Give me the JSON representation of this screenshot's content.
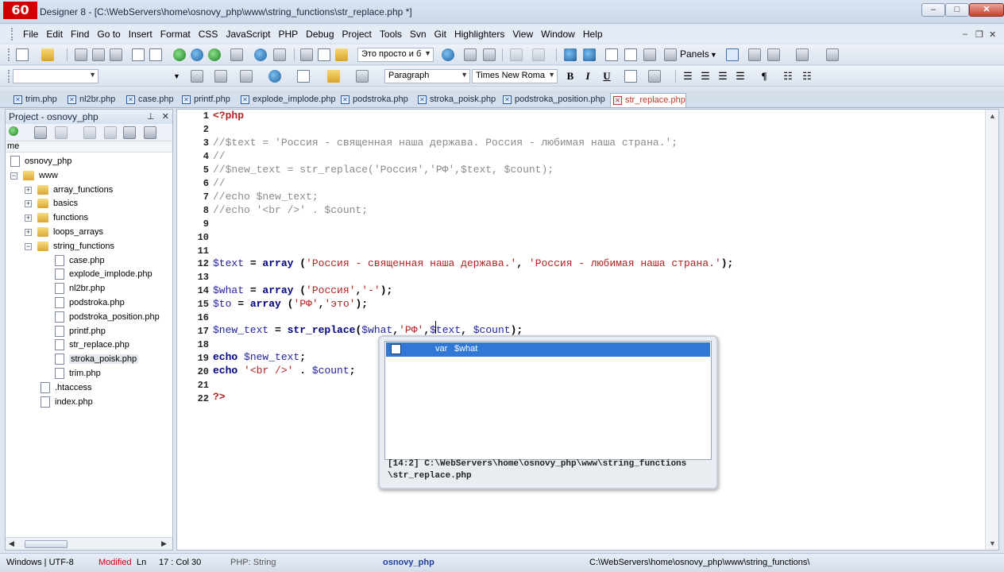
{
  "app": {
    "logo_text": "60",
    "title": "Designer 8 - [C:\\WebServers\\home\\osnovy_php\\www\\string_functions\\str_replace.php *]"
  },
  "window_controls": {
    "minimize": "–",
    "maximize": "□",
    "close": "✕"
  },
  "menu": {
    "items": [
      "File",
      "Edit",
      "Find",
      "Go to",
      "Insert",
      "Format",
      "CSS",
      "JavaScript",
      "PHP",
      "Debug",
      "Project",
      "Tools",
      "Svn",
      "Git",
      "Highlighters",
      "View",
      "Window",
      "Help"
    ],
    "mdi_minimize": "–",
    "mdi_restore": "❐",
    "mdi_close": "✕"
  },
  "toolbar1": {
    "search_combo_value": "Это просто и б",
    "panels_label": "Panels"
  },
  "toolbar2": {
    "left_combo_value": "",
    "paragraph_value": "Paragraph",
    "font_value": "Times New Roma",
    "bold": "B",
    "italic": "I",
    "underline": "U",
    "pilcrow": "¶"
  },
  "tabs": [
    {
      "label": "trim.php",
      "active": false
    },
    {
      "label": "nl2br.php",
      "active": false
    },
    {
      "label": "case.php",
      "active": false
    },
    {
      "label": "printf.php",
      "active": false
    },
    {
      "label": "explode_implode.php",
      "active": false
    },
    {
      "label": "podstroka.php",
      "active": false
    },
    {
      "label": "stroka_poisk.php",
      "active": false
    },
    {
      "label": "podstroka_position.php",
      "active": false
    },
    {
      "label": "str_replace.php",
      "active": true
    }
  ],
  "project_panel": {
    "title": "Project - osnovy_php",
    "pin": "⊥",
    "close": "✕",
    "column_header": "me",
    "tree": [
      {
        "label": "osnovy_php",
        "kind": "project"
      },
      {
        "label": "www",
        "kind": "folder",
        "expanded": true
      },
      {
        "label": "array_functions",
        "kind": "folder"
      },
      {
        "label": "basics",
        "kind": "folder"
      },
      {
        "label": "functions",
        "kind": "folder"
      },
      {
        "label": "loops_arrays",
        "kind": "folder"
      },
      {
        "label": "string_functions",
        "kind": "folder",
        "expanded": true
      },
      {
        "label": "case.php",
        "kind": "file"
      },
      {
        "label": "explode_implode.php",
        "kind": "file"
      },
      {
        "label": "nl2br.php",
        "kind": "file"
      },
      {
        "label": "podstroka.php",
        "kind": "file"
      },
      {
        "label": "podstroka_position.php",
        "kind": "file"
      },
      {
        "label": "printf.php",
        "kind": "file"
      },
      {
        "label": "str_replace.php",
        "kind": "file"
      },
      {
        "label": "stroka_poisk.php",
        "kind": "file",
        "selected": true
      },
      {
        "label": "trim.php",
        "kind": "file"
      },
      {
        "label": ".htaccess",
        "kind": "file"
      },
      {
        "label": "index.php",
        "kind": "file"
      }
    ]
  },
  "editor": {
    "line_numbers": [
      "1",
      "2",
      "3",
      "4",
      "5",
      "6",
      "7",
      "8",
      "9",
      "10",
      "11",
      "12",
      "13",
      "14",
      "15",
      "16",
      "17",
      "18",
      "19",
      "20",
      "21",
      "22"
    ],
    "lines": {
      "l1": "<?php",
      "l3": "//$text = 'Россия - священная наша держава. Россия - любимая наша страна.';",
      "l4": "//",
      "l5": "//$new_text = str_replace('Россия','РФ',$text, $count);",
      "l6": "//",
      "l7": "//echo $new_text;",
      "l8": "//echo '<br />' . $count;",
      "l12_var": "$text",
      "l12_eq": " = ",
      "l12_kw": "array",
      "l12_p1": " (",
      "l12_s1": "'Россия - священная наша держава.'",
      "l12_c": ", ",
      "l12_s2": "'Россия - любимая наша страна.'",
      "l12_end": ");",
      "l14_var": "$what",
      "l14_eq": " = ",
      "l14_kw": "array",
      "l14_p1": " (",
      "l14_s1": "'Россия'",
      "l14_c": ",",
      "l14_s2": "'-'",
      "l14_end": ");",
      "l15_var": "$to",
      "l15_eq": " = ",
      "l15_kw": "array",
      "l15_p1": " (",
      "l15_s1": "'РФ'",
      "l15_c": ",",
      "l15_s2": "'это'",
      "l15_end": ");",
      "l17_var": "$new_text",
      "l17_eq": " = ",
      "l17_kw": "str_replace",
      "l17_p": "(",
      "l17_a1": "$what",
      "l17_c1": ",",
      "l17_s1": "'РФ'",
      "l17_c2": ",",
      "l17_a2": "$text",
      "l17_c3": ", ",
      "l17_a3": "$count",
      "l17_end": ");",
      "l19_kw": "echo",
      "l19_var": " $new_text",
      "l19_end": ";",
      "l20_kw": "echo",
      "l20_s": " '<br />'",
      "l20_dot": " . ",
      "l20_var": "$count",
      "l20_end": ";",
      "l22": "?>"
    }
  },
  "autocomplete": {
    "item_type": "var",
    "item_name": "$what",
    "path_line1": "[14:2] C:\\WebServers\\home\\osnovy_php\\www\\string_functions",
    "path_line2": "\\str_replace.php"
  },
  "status": {
    "encoding": "Windows | UTF-8",
    "modified": "Modified",
    "ln_label": "Ln",
    "position": "17 : Col 30",
    "context": "PHP: String",
    "project": "osnovy_php",
    "path": "C:\\WebServers\\home\\osnovy_php\\www\\string_functions\\"
  },
  "colors": {
    "logo_bg": "#d10000",
    "active_tab_text": "#c0392b",
    "selection_blue": "#3178d6",
    "string_red": "#b22222",
    "comment_gray": "#8a8a8a",
    "modified_red": "#d0021b",
    "project_blue": "#1f3fa0"
  }
}
